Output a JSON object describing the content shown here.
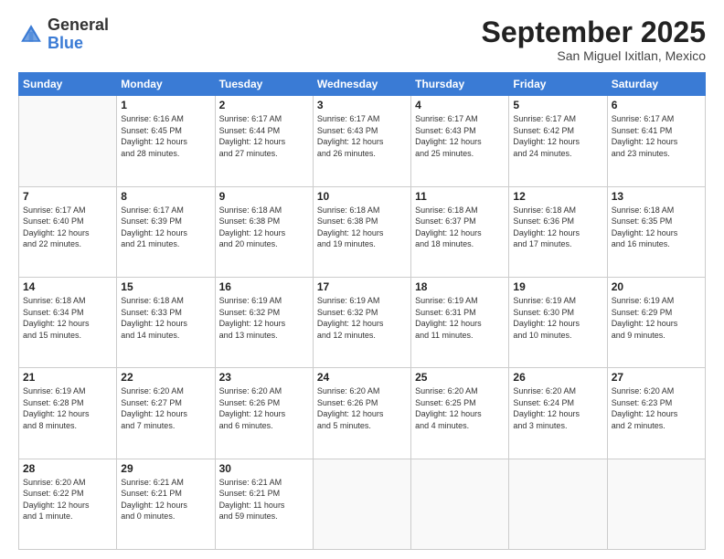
{
  "header": {
    "logo": {
      "general": "General",
      "blue": "Blue"
    },
    "title": "September 2025",
    "location": "San Miguel Ixitlan, Mexico"
  },
  "days_of_week": [
    "Sunday",
    "Monday",
    "Tuesday",
    "Wednesday",
    "Thursday",
    "Friday",
    "Saturday"
  ],
  "weeks": [
    [
      {
        "day": "",
        "info": ""
      },
      {
        "day": "1",
        "info": "Sunrise: 6:16 AM\nSunset: 6:45 PM\nDaylight: 12 hours\nand 28 minutes."
      },
      {
        "day": "2",
        "info": "Sunrise: 6:17 AM\nSunset: 6:44 PM\nDaylight: 12 hours\nand 27 minutes."
      },
      {
        "day": "3",
        "info": "Sunrise: 6:17 AM\nSunset: 6:43 PM\nDaylight: 12 hours\nand 26 minutes."
      },
      {
        "day": "4",
        "info": "Sunrise: 6:17 AM\nSunset: 6:43 PM\nDaylight: 12 hours\nand 25 minutes."
      },
      {
        "day": "5",
        "info": "Sunrise: 6:17 AM\nSunset: 6:42 PM\nDaylight: 12 hours\nand 24 minutes."
      },
      {
        "day": "6",
        "info": "Sunrise: 6:17 AM\nSunset: 6:41 PM\nDaylight: 12 hours\nand 23 minutes."
      }
    ],
    [
      {
        "day": "7",
        "info": "Sunrise: 6:17 AM\nSunset: 6:40 PM\nDaylight: 12 hours\nand 22 minutes."
      },
      {
        "day": "8",
        "info": "Sunrise: 6:17 AM\nSunset: 6:39 PM\nDaylight: 12 hours\nand 21 minutes."
      },
      {
        "day": "9",
        "info": "Sunrise: 6:18 AM\nSunset: 6:38 PM\nDaylight: 12 hours\nand 20 minutes."
      },
      {
        "day": "10",
        "info": "Sunrise: 6:18 AM\nSunset: 6:38 PM\nDaylight: 12 hours\nand 19 minutes."
      },
      {
        "day": "11",
        "info": "Sunrise: 6:18 AM\nSunset: 6:37 PM\nDaylight: 12 hours\nand 18 minutes."
      },
      {
        "day": "12",
        "info": "Sunrise: 6:18 AM\nSunset: 6:36 PM\nDaylight: 12 hours\nand 17 minutes."
      },
      {
        "day": "13",
        "info": "Sunrise: 6:18 AM\nSunset: 6:35 PM\nDaylight: 12 hours\nand 16 minutes."
      }
    ],
    [
      {
        "day": "14",
        "info": "Sunrise: 6:18 AM\nSunset: 6:34 PM\nDaylight: 12 hours\nand 15 minutes."
      },
      {
        "day": "15",
        "info": "Sunrise: 6:18 AM\nSunset: 6:33 PM\nDaylight: 12 hours\nand 14 minutes."
      },
      {
        "day": "16",
        "info": "Sunrise: 6:19 AM\nSunset: 6:32 PM\nDaylight: 12 hours\nand 13 minutes."
      },
      {
        "day": "17",
        "info": "Sunrise: 6:19 AM\nSunset: 6:32 PM\nDaylight: 12 hours\nand 12 minutes."
      },
      {
        "day": "18",
        "info": "Sunrise: 6:19 AM\nSunset: 6:31 PM\nDaylight: 12 hours\nand 11 minutes."
      },
      {
        "day": "19",
        "info": "Sunrise: 6:19 AM\nSunset: 6:30 PM\nDaylight: 12 hours\nand 10 minutes."
      },
      {
        "day": "20",
        "info": "Sunrise: 6:19 AM\nSunset: 6:29 PM\nDaylight: 12 hours\nand 9 minutes."
      }
    ],
    [
      {
        "day": "21",
        "info": "Sunrise: 6:19 AM\nSunset: 6:28 PM\nDaylight: 12 hours\nand 8 minutes."
      },
      {
        "day": "22",
        "info": "Sunrise: 6:20 AM\nSunset: 6:27 PM\nDaylight: 12 hours\nand 7 minutes."
      },
      {
        "day": "23",
        "info": "Sunrise: 6:20 AM\nSunset: 6:26 PM\nDaylight: 12 hours\nand 6 minutes."
      },
      {
        "day": "24",
        "info": "Sunrise: 6:20 AM\nSunset: 6:26 PM\nDaylight: 12 hours\nand 5 minutes."
      },
      {
        "day": "25",
        "info": "Sunrise: 6:20 AM\nSunset: 6:25 PM\nDaylight: 12 hours\nand 4 minutes."
      },
      {
        "day": "26",
        "info": "Sunrise: 6:20 AM\nSunset: 6:24 PM\nDaylight: 12 hours\nand 3 minutes."
      },
      {
        "day": "27",
        "info": "Sunrise: 6:20 AM\nSunset: 6:23 PM\nDaylight: 12 hours\nand 2 minutes."
      }
    ],
    [
      {
        "day": "28",
        "info": "Sunrise: 6:20 AM\nSunset: 6:22 PM\nDaylight: 12 hours\nand 1 minute."
      },
      {
        "day": "29",
        "info": "Sunrise: 6:21 AM\nSunset: 6:21 PM\nDaylight: 12 hours\nand 0 minutes."
      },
      {
        "day": "30",
        "info": "Sunrise: 6:21 AM\nSunset: 6:21 PM\nDaylight: 11 hours\nand 59 minutes."
      },
      {
        "day": "",
        "info": ""
      },
      {
        "day": "",
        "info": ""
      },
      {
        "day": "",
        "info": ""
      },
      {
        "day": "",
        "info": ""
      }
    ]
  ]
}
